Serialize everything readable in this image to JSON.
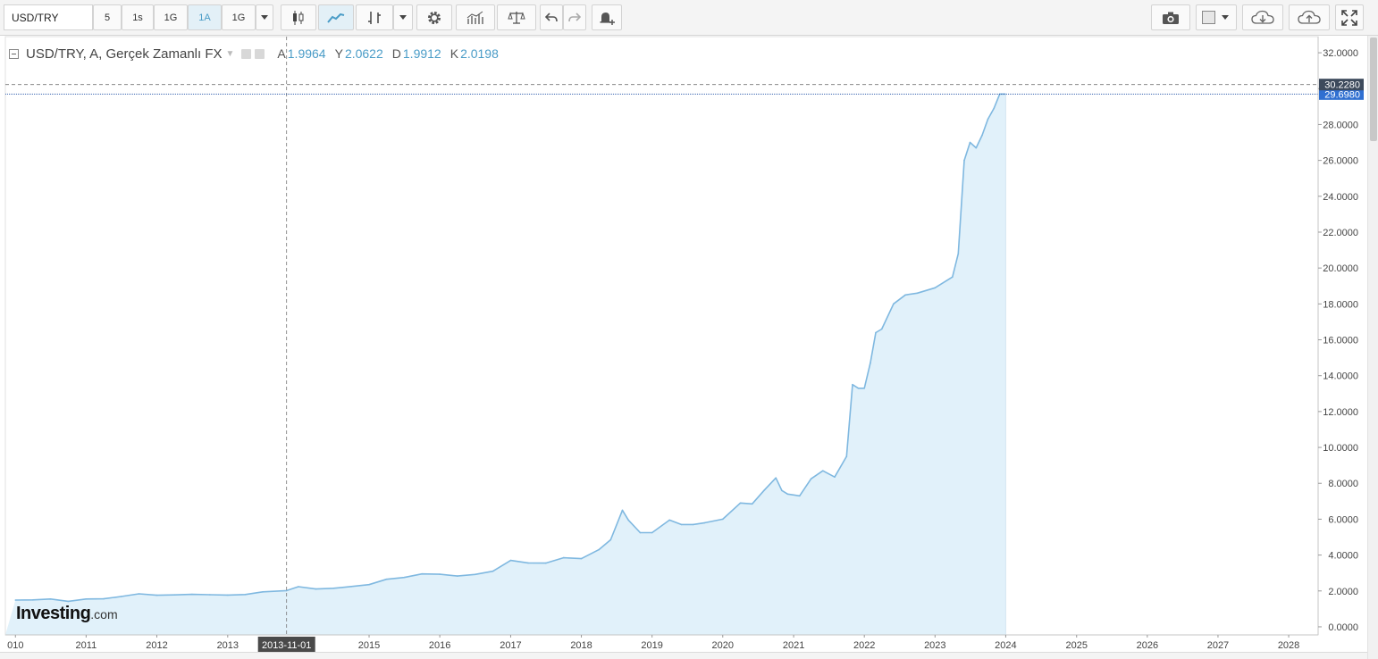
{
  "toolbar": {
    "symbol": "USD/TRY",
    "intervals": [
      "5",
      "1s",
      "1G",
      "1A",
      "1G"
    ],
    "active_interval_index": 3
  },
  "legend": {
    "title": "USD/TRY, A, Gerçek Zamanlı FX",
    "open_key": "A",
    "open_value": "1.9964",
    "high_key": "Y",
    "high_value": "2.0622",
    "low_key": "D",
    "low_value": "1.9912",
    "close_key": "K",
    "close_value": "2.0198"
  },
  "watermark": {
    "brand": "Investing",
    "suffix": ".com"
  },
  "colors": {
    "line": "#7fb8e0",
    "area": "#e1f1fa",
    "price_tag_last": "#3d4a5c",
    "price_tag_current": "#2f6fd1",
    "crosshair_label": "#4a4a4a"
  },
  "chart_data": {
    "type": "area",
    "x": [
      "2010-01",
      "2010-04",
      "2010-07",
      "2010-10",
      "2011-01",
      "2011-04",
      "2011-07",
      "2011-10",
      "2012-01",
      "2012-04",
      "2012-07",
      "2012-10",
      "2013-01",
      "2013-04",
      "2013-07",
      "2013-11",
      "2014-01",
      "2014-04",
      "2014-07",
      "2014-10",
      "2015-01",
      "2015-04",
      "2015-07",
      "2015-10",
      "2016-01",
      "2016-04",
      "2016-07",
      "2016-10",
      "2017-01",
      "2017-04",
      "2017-07",
      "2017-10",
      "2018-01",
      "2018-04",
      "2018-06",
      "2018-08",
      "2018-09",
      "2018-11",
      "2019-01",
      "2019-04",
      "2019-06",
      "2019-08",
      "2019-10",
      "2020-01",
      "2020-04",
      "2020-06",
      "2020-08",
      "2020-10",
      "2020-11",
      "2020-12",
      "2021-02",
      "2021-04",
      "2021-06",
      "2021-08",
      "2021-10",
      "2021-11",
      "2021-12",
      "2022-01",
      "2022-02",
      "2022-03",
      "2022-04",
      "2022-06",
      "2022-08",
      "2022-10",
      "2023-01",
      "2023-04",
      "2023-05",
      "2023-06",
      "2023-07",
      "2023-08",
      "2023-09",
      "2023-10",
      "2023-11",
      "2023-12"
    ],
    "values": [
      1.49,
      1.5,
      1.55,
      1.42,
      1.55,
      1.56,
      1.69,
      1.84,
      1.76,
      1.78,
      1.81,
      1.79,
      1.77,
      1.8,
      1.95,
      2.02,
      2.24,
      2.11,
      2.15,
      2.25,
      2.35,
      2.65,
      2.75,
      2.95,
      2.93,
      2.83,
      2.92,
      3.1,
      3.7,
      3.56,
      3.55,
      3.85,
      3.8,
      4.3,
      4.85,
      6.5,
      5.95,
      5.25,
      5.25,
      5.95,
      5.7,
      5.7,
      5.8,
      6.0,
      6.9,
      6.85,
      7.6,
      8.3,
      7.6,
      7.4,
      7.3,
      8.25,
      8.7,
      8.35,
      9.5,
      13.5,
      13.3,
      13.3,
      14.7,
      16.4,
      16.6,
      18.0,
      18.5,
      18.6,
      18.9,
      19.5,
      20.8,
      26.0,
      27.0,
      26.7,
      27.4,
      28.3,
      28.9,
      29.7
    ],
    "xlim": [
      "2009-11-10",
      "2028-06-01"
    ],
    "ylim": [
      -0.45,
      32.9
    ],
    "y_ticks": [
      0,
      2,
      4,
      6,
      8,
      10,
      12,
      14,
      16,
      18,
      20,
      22,
      24,
      26,
      28,
      30,
      32
    ],
    "y_tick_labels": [
      "0.0000",
      "2.0000",
      "4.0000",
      "6.0000",
      "8.0000",
      "10.0000",
      "12.0000",
      "14.0000",
      "16.0000",
      "18.0000",
      "20.0000",
      "22.0000",
      "24.0000",
      "26.0000",
      "28.0000",
      "30.0000",
      "32.0000"
    ],
    "x_tick_labels": [
      "010",
      "2011",
      "2012",
      "2013",
      "2015",
      "2016",
      "2017",
      "2018",
      "2019",
      "2020",
      "2021",
      "2022",
      "2023",
      "2024",
      "2025",
      "2026",
      "2027",
      "2028"
    ],
    "x_tick_dates": [
      "2010-01-01",
      "2011-01-01",
      "2012-01-01",
      "2013-01-01",
      "2015-01-01",
      "2016-01-01",
      "2017-01-01",
      "2018-01-01",
      "2019-01-01",
      "2020-01-01",
      "2021-01-01",
      "2022-01-01",
      "2023-01-01",
      "2024-01-01",
      "2025-01-01",
      "2026-01-01",
      "2027-01-01",
      "2028-01-01"
    ],
    "crosshair_date": "2013-11-01",
    "crosshair_label": "2013-11-01",
    "last_price": 30.228,
    "last_price_label": "30.2280",
    "current_price": 29.698,
    "current_price_label": "29.6980",
    "grid": false
  }
}
